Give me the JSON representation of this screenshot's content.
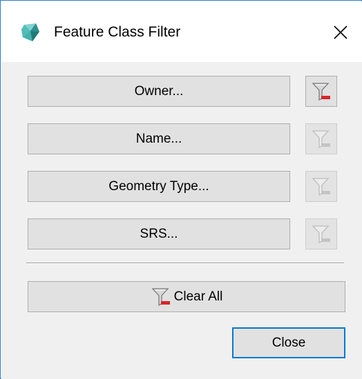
{
  "window": {
    "title": "Feature Class Filter",
    "app_icon": "fme-gem-icon",
    "close_icon": "close-icon",
    "accent_color": "#2b79d0"
  },
  "filters": [
    {
      "label": "Owner...",
      "filter_icon": "funnel-remove-icon",
      "filter_active": true
    },
    {
      "label": "Name...",
      "filter_icon": "funnel-remove-icon",
      "filter_active": false
    },
    {
      "label": "Geometry Type...",
      "filter_icon": "funnel-remove-icon",
      "filter_active": false
    },
    {
      "label": "SRS...",
      "filter_icon": "funnel-remove-icon",
      "filter_active": false
    }
  ],
  "actions": {
    "clear_all_label": "Clear All",
    "clear_all_icon": "funnel-remove-icon",
    "close_label": "Close"
  }
}
